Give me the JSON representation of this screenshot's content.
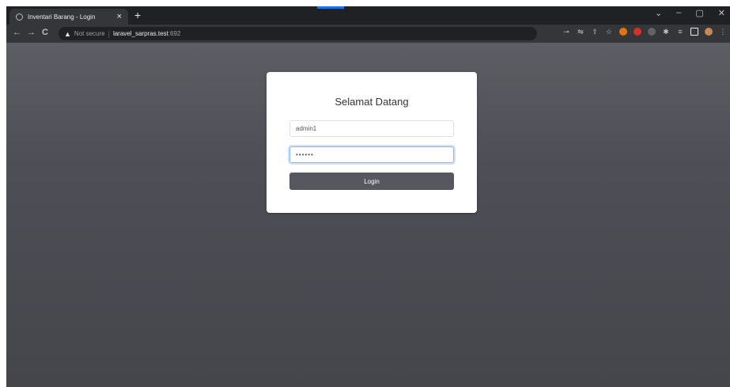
{
  "browser": {
    "tab_title": "Inventari Barang - Login",
    "tab_close": "×",
    "new_tab": "+",
    "window_controls": [
      "⌄",
      "–",
      "▢",
      "✕"
    ],
    "nav": {
      "back": "←",
      "forward": "→",
      "reload": "C"
    },
    "security_warning": "▲",
    "security_text": "Not secure",
    "separator": "|",
    "url_host": "laravel_sarpras.test",
    "url_port": ":692"
  },
  "login": {
    "heading": "Selamat Datang",
    "username_value": "admin1",
    "password_value": "••••••",
    "submit_label": "Login"
  },
  "colors": {
    "page_bg": "#4e4f56",
    "button_bg": "#56575f",
    "card_bg": "#ffffff"
  }
}
